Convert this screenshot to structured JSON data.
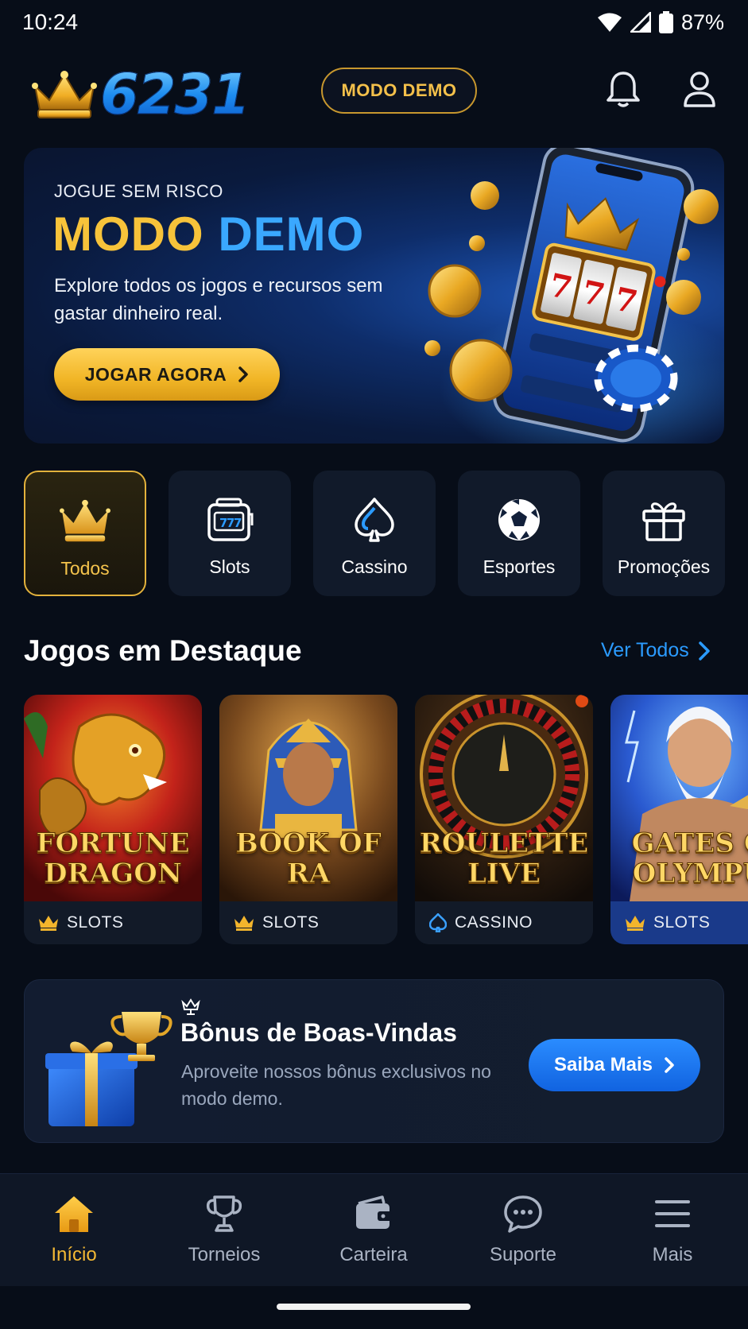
{
  "status_bar": {
    "time": "10:24",
    "battery": "87%"
  },
  "header": {
    "logo_text": "6231",
    "demo_badge": "MODO DEMO",
    "icons": [
      "bell-icon",
      "user-icon"
    ]
  },
  "hero": {
    "eyebrow": "JOGUE SEM RISCO",
    "title_part1": "MODO",
    "title_part2": "DEMO",
    "description": "Explore todos os jogos e recursos sem gastar dinheiro real.",
    "cta_label": "JOGAR AGORA"
  },
  "categories": [
    {
      "label": "Todos",
      "icon": "crown-icon",
      "active": true
    },
    {
      "label": "Slots",
      "icon": "slot-machine-icon",
      "active": false
    },
    {
      "label": "Cassino",
      "icon": "spade-icon",
      "active": false
    },
    {
      "label": "Esportes",
      "icon": "soccer-ball-icon",
      "active": false
    },
    {
      "label": "Promoções",
      "icon": "gift-icon",
      "active": false
    }
  ],
  "featured": {
    "title": "Jogos em Destaque",
    "see_all": "Ver Todos",
    "games": [
      {
        "title_line1": "FORTUNE",
        "title_line2": "DRAGON",
        "category": "SLOTS",
        "category_icon": "crown-icon"
      },
      {
        "title_line1": "BOOK OF",
        "title_line2": "RA",
        "category": "SLOTS",
        "category_icon": "crown-icon"
      },
      {
        "title_line1": "ROULETTE",
        "title_line2": "LIVE",
        "category": "CASSINO",
        "category_icon": "spade-icon"
      },
      {
        "title_line1": "GATES O",
        "title_line2": "OLYMPU",
        "category": "SLOTS",
        "category_icon": "crown-icon"
      }
    ]
  },
  "bonus": {
    "title": "Bônus de Boas-Vindas",
    "description": "Aproveite nossos bônus exclusivos no modo demo.",
    "cta_label": "Saiba Mais"
  },
  "bottom_nav": [
    {
      "label": "Início",
      "icon": "home-icon",
      "active": true
    },
    {
      "label": "Torneios",
      "icon": "trophy-icon",
      "active": false
    },
    {
      "label": "Carteira",
      "icon": "wallet-icon",
      "active": false
    },
    {
      "label": "Suporte",
      "icon": "chat-icon",
      "active": false
    },
    {
      "label": "Mais",
      "icon": "menu-icon",
      "active": false
    }
  ],
  "colors": {
    "gold": "#f4b934",
    "blue_accent": "#2b9bff",
    "background": "#070d18"
  }
}
